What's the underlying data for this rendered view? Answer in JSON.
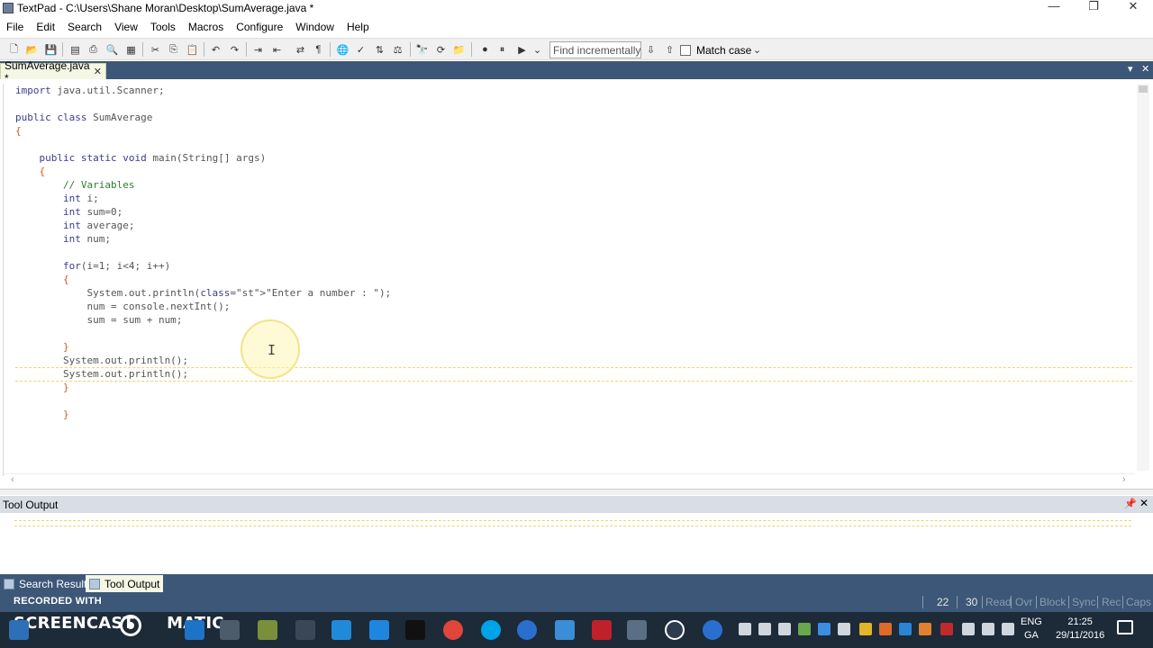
{
  "window": {
    "title": "TextPad - C:\\Users\\Shane Moran\\Desktop\\SumAverage.java *",
    "controls": [
      "—",
      "❐",
      "✕"
    ]
  },
  "menu": {
    "items": [
      "File",
      "Edit",
      "Search",
      "View",
      "Tools",
      "Macros",
      "Configure",
      "Window",
      "Help"
    ]
  },
  "toolbar": {
    "find_placeholder": "Find incrementally",
    "match_case_label": "Match case"
  },
  "document_tab": {
    "label": "SumAverage.java *",
    "close": "✕"
  },
  "editor": {
    "lines": [
      "import java.util.Scanner;",
      "",
      "public class SumAverage",
      "{",
      "",
      "    public static void main(String[] args)",
      "    {",
      "        // Variables",
      "        int i;",
      "        int sum=0;",
      "        int average;",
      "        int num;",
      "",
      "        for(i=1; i<4; i++)",
      "        {",
      "            System.out.println(\"Enter a number : \");",
      "            num = console.nextInt();",
      "            sum = sum + num;",
      "",
      "        }",
      "        System.out.println();",
      "        System.out.println();",
      "        }",
      "",
      "        }"
    ],
    "current_line_index": 21
  },
  "tool_output": {
    "title": "Tool Output"
  },
  "bottom_tabs": [
    {
      "label": "Search Results",
      "active": false
    },
    {
      "label": "Tool Output",
      "active": true
    }
  ],
  "statusbar": {
    "recorded_label": "RECORDED WITH",
    "line": "22",
    "column": "30",
    "indicators": [
      "Read",
      "Ovr",
      "Block",
      "Sync",
      "Rec",
      "Caps"
    ]
  },
  "taskbar": {
    "brand_left": "SCREENCAST",
    "brand_right": "MATIC",
    "language": "ENG",
    "language_sub": "GA",
    "time": "21:25",
    "date": "29/11/2016"
  }
}
